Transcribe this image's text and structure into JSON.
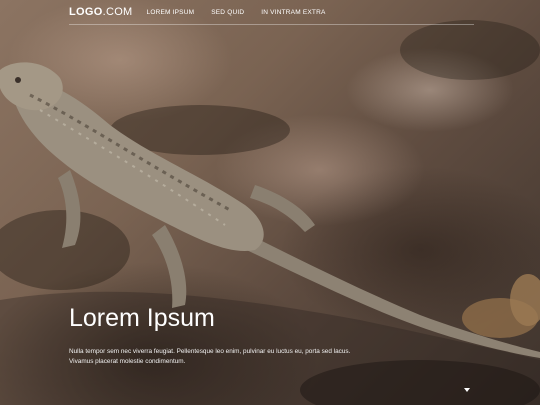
{
  "header": {
    "logo": {
      "main": "LOGO",
      "suffix": ".COM"
    },
    "nav": [
      "LOREM IPSUM",
      "SED QUID",
      "IN VINTRAM EXTRA"
    ]
  },
  "hero": {
    "title": "Lorem Ipsum",
    "text_line1": "Nulla tempor sem nec viverra feugiat. Pellentesque leo enim, pulvinar eu luctus eu, porta sed lacus.",
    "text_line2": "Vivamus placerat molestie condimentum.",
    "image": "lizard-on-rock-photo",
    "scroll_icon": "caret-down-icon"
  }
}
